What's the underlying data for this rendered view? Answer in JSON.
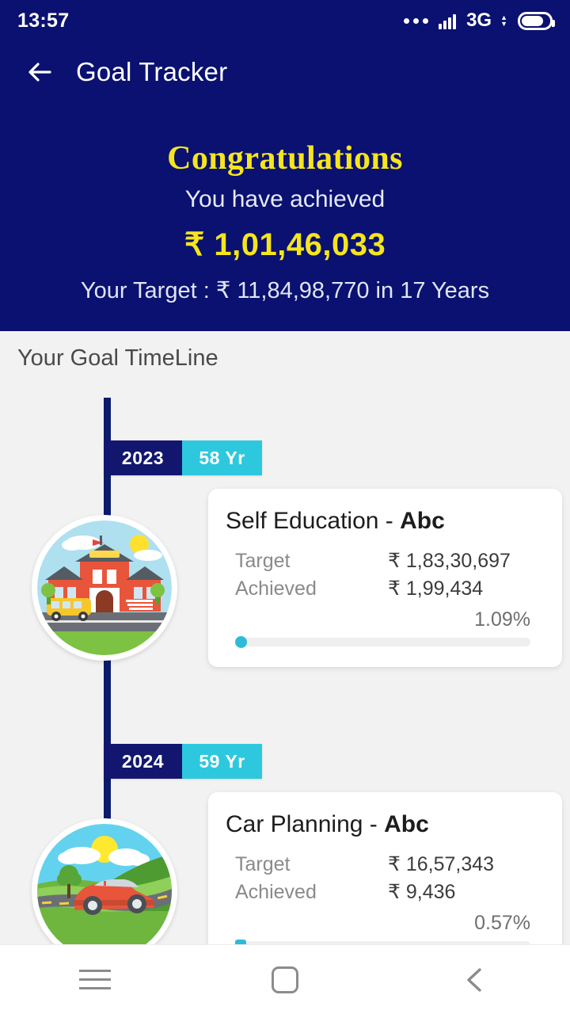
{
  "status_bar": {
    "time": "13:57",
    "network_label": "3G",
    "icons": [
      "more-dots-icon",
      "signal-icon",
      "network-3g-icon",
      "battery-icon"
    ]
  },
  "app_bar": {
    "back_icon": "arrow-left-icon",
    "title": "Goal Tracker"
  },
  "hero": {
    "congrats": "Congratulations",
    "achieved_label": "You have achieved",
    "achieved_amount": "₹ 1,01,46,033",
    "target_line": "Your Target : ₹ 11,84,98,770 in 17 Years",
    "background_color": "#0a1170",
    "accent_color": "#f5e51c"
  },
  "timeline": {
    "section_title": "Your Goal TimeLine",
    "rail_color": "#0d1b6e",
    "goals": [
      {
        "year": "2023",
        "age": "58 Yr",
        "icon": "school-illustration",
        "title_main": "Self Education",
        "title_sep": " - ",
        "title_bold": "Abc",
        "target_label": "Target",
        "target_value": "₹ 1,83,30,697",
        "achieved_label": "Achieved",
        "achieved_value": "₹ 1,99,434",
        "percent": "1.09%",
        "progress": 1.09
      },
      {
        "year": "2024",
        "age": "59 Yr",
        "icon": "car-illustration",
        "title_main": "Car Planning",
        "title_sep": " - ",
        "title_bold": "Abc",
        "target_label": "Target",
        "target_value": "₹ 16,57,343",
        "achieved_label": "Achieved",
        "achieved_value": "₹ 9,436",
        "percent": "0.57%",
        "progress": 0.57
      }
    ]
  },
  "nav_bar": {
    "recents": "menu-icon",
    "home": "home-square-icon",
    "back": "chevron-left-icon"
  }
}
